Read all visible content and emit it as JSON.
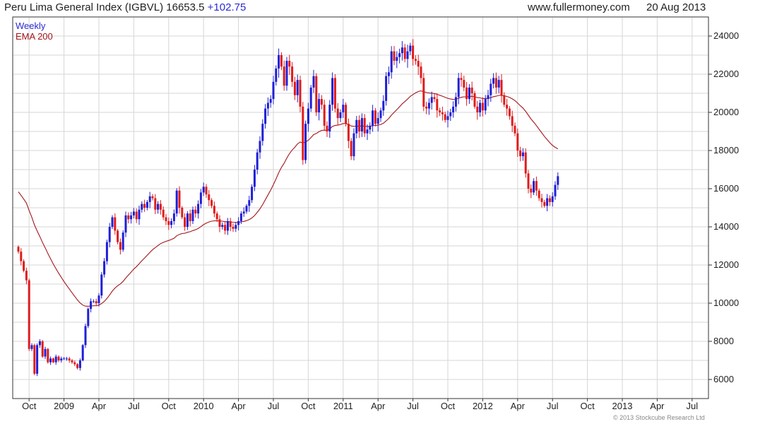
{
  "header": {
    "title": "Peru Lima General Index (IGBVL) 16653.5",
    "change": "+102.75",
    "site": "www.fullermoney.com",
    "date": "20 Aug 2013"
  },
  "footer": {
    "copyright": "© 2013 Stockcube Research Ltd"
  },
  "colors": {
    "up": "#1f1fd6",
    "down": "#e01b1b",
    "ema": "#a3161b",
    "grid": "#d6d6d6"
  },
  "chart_data": {
    "type": "candlestick",
    "title": "Peru Lima General Index (IGBVL)",
    "timeframe_label": "Weekly",
    "indicator_label": "EMA 200",
    "y_ticks": [
      "6000",
      "8000",
      "10000",
      "12000",
      "14000",
      "16000",
      "18000",
      "20000",
      "22000",
      "24000"
    ],
    "ylim": [
      5000,
      25000
    ],
    "x_ticks": [
      "Oct",
      "2009",
      "Apr",
      "Jul",
      "Oct",
      "2010",
      "Apr",
      "Jul",
      "Oct",
      "2011",
      "Apr",
      "Jul",
      "Oct",
      "2012",
      "Apr",
      "Jul",
      "Oct",
      "2013",
      "Apr",
      "Jul"
    ],
    "x_tick_weeks": [
      4,
      17,
      30,
      43,
      56,
      69,
      82,
      95,
      108,
      121,
      134,
      147,
      160,
      173,
      186,
      199,
      212,
      225,
      238,
      251
    ],
    "grid": true,
    "legend_position": "top-left",
    "weekly_close": [
      12700,
      12200,
      11700,
      11200,
      7600,
      7800,
      6300,
      7800,
      8000,
      7200,
      7600,
      6900,
      7100,
      6900,
      7200,
      7000,
      7100,
      7100,
      7100,
      7000,
      6900,
      6800,
      6600,
      7000,
      7800,
      8800,
      9700,
      10100,
      10100,
      10000,
      10400,
      11500,
      12200,
      13200,
      14000,
      14500,
      13800,
      13200,
      12800,
      13700,
      14600,
      14400,
      14600,
      14800,
      14400,
      14900,
      15200,
      15000,
      15300,
      15600,
      15500,
      14900,
      15200,
      14900,
      14500,
      14300,
      14100,
      14300,
      14700,
      15900,
      15000,
      14500,
      14000,
      14700,
      14300,
      14900,
      14700,
      15200,
      15800,
      16100,
      15700,
      15400,
      15100,
      14700,
      14400,
      14000,
      14100,
      13800,
      14300,
      14000,
      13900,
      14100,
      14300,
      14700,
      14800,
      15100,
      15400,
      16100,
      17000,
      17900,
      18500,
      19400,
      20200,
      20500,
      20700,
      21600,
      22300,
      23000,
      22400,
      21400,
      22700,
      22400,
      21600,
      20900,
      21700,
      20300,
      17500,
      19400,
      20200,
      21300,
      21900,
      20000,
      20700,
      20400,
      19300,
      19000,
      20400,
      21800,
      20200,
      19700,
      20000,
      20400,
      19400,
      18500,
      17700,
      18900,
      19600,
      19000,
      19700,
      18900,
      19100,
      19300,
      20100,
      19400,
      19700,
      20100,
      20600,
      21900,
      22100,
      23200,
      22700,
      22900,
      23100,
      23400,
      22800,
      23200,
      23500,
      22800,
      22700,
      22400,
      21800,
      20300,
      20200,
      20500,
      20800,
      20700,
      20100,
      20000,
      19900,
      19600,
      19800,
      20000,
      20300,
      20800,
      21800,
      21700,
      21300,
      20700,
      21300,
      21000,
      20300,
      20000,
      20500,
      20100,
      20700,
      20900,
      21500,
      21800,
      21300,
      21700,
      20900,
      20400,
      20200,
      19800,
      19300,
      18900,
      18000,
      17700,
      17900,
      16800,
      16000,
      15800,
      16400,
      15900,
      15500,
      15300,
      15100,
      15500,
      15300,
      15600,
      16200,
      16653.5
    ]
  }
}
